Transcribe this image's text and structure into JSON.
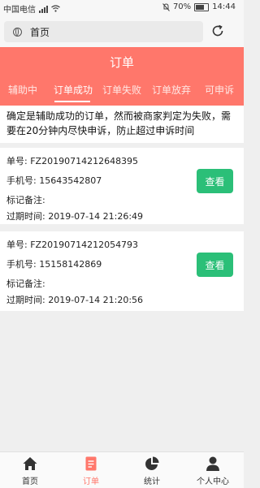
{
  "status_bar": {
    "carrier": "中国电信",
    "battery": "70%",
    "time": "14:44"
  },
  "address_bar": {
    "url_text": "首页"
  },
  "header": {
    "title": "订单",
    "tabs": [
      {
        "label": "辅助中",
        "active": false
      },
      {
        "label": "订单成功",
        "active": true
      },
      {
        "label": "订单失败",
        "active": false
      },
      {
        "label": "订单放弃",
        "active": false
      },
      {
        "label": "可申诉",
        "active": false
      }
    ]
  },
  "notice": {
    "text": "确定是辅助成功的订单，然而被商家判定为失败，需要在20分钟内尽快申诉，防止超过申诉时间"
  },
  "orders": [
    {
      "order_label": "单号:",
      "order_no": "FZ20190714212648395",
      "phone_label": "手机号:",
      "phone": "15643542807",
      "remark_label": "标记备注:",
      "expire_label": "过期时间:",
      "expire_time": "2019-07-14 21:26:49",
      "button_label": "查看"
    },
    {
      "order_label": "单号:",
      "order_no": "FZ20190714212054793",
      "phone_label": "手机号:",
      "phone": "15158142869",
      "remark_label": "标记备注:",
      "expire_label": "过期时间:",
      "expire_time": "2019-07-14 21:20:56",
      "button_label": "查看"
    }
  ],
  "bottom_nav": {
    "items": [
      {
        "label": "首页",
        "icon": "home-icon",
        "active": false
      },
      {
        "label": "订单",
        "icon": "order-icon",
        "active": true
      },
      {
        "label": "统计",
        "icon": "pie-chart-icon",
        "active": false
      },
      {
        "label": "个人中心",
        "icon": "user-icon",
        "active": false
      }
    ]
  },
  "colors": {
    "header_bg": "#ff776b",
    "view_button": "#2bbf78",
    "nav_active": "#ff776b"
  }
}
